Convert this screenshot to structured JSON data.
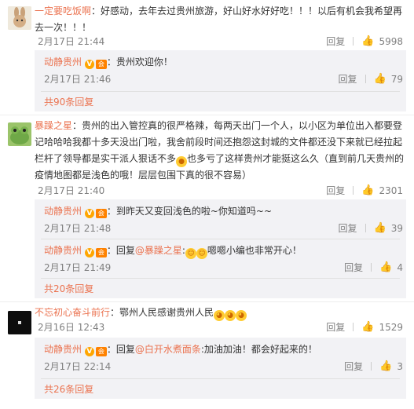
{
  "comments": [
    {
      "user": "一定要吃饭啊",
      "text": "：好感动，去年去过贵州旅游，好山好水好好吃！！！以后有机会我希望再去一次！！！",
      "time": "2月17日 21:44",
      "reply": "回复",
      "likes": "5998",
      "avatar_icon": "rabbit-avatar",
      "replies": [
        {
          "user": "动静贵州",
          "text": "：贵州欢迎你！",
          "time": "2月17日 21:46",
          "reply": "回复",
          "likes": "79"
        }
      ],
      "more": "共90条回复"
    },
    {
      "user": "暴躁之星",
      "text": "：贵州的出入管控真的很严格辣，每两天出门一个人，以小区为单位出入都要登记哈哈哈我都十多天没出门啦，我舍前段时间还抱怨这封城的文件都还没下来就已经拉起栏杆了领导都是实干派人狠话不多",
      "text_tail": "也多亏了这样贵州才能挺这么久（直到前几天贵州的疫情地图都是浅色的哦！层层包围下真的很不容易）",
      "time": "2月17日 21:40",
      "reply": "回复",
      "likes": "2301",
      "avatar_icon": "frog-avatar",
      "replies": [
        {
          "user": "动静贵州",
          "text": "：到昨天又变回浅色的啦~你知道吗~~",
          "time": "2月17日 21:48",
          "reply": "回复",
          "likes": "39"
        },
        {
          "user": "动静贵州",
          "text_pre": "：回复",
          "mention": "@暴躁之星",
          "text": ":",
          "text_post": "嗯嗯小编也非常开心！",
          "time": "2月17日 21:49",
          "reply": "回复",
          "likes": "4"
        }
      ],
      "more": "共20条回复"
    },
    {
      "user": "不忘初心奋斗前行",
      "text": "：鄂州人民感谢贵州人民",
      "time": "2月16日 12:43",
      "reply": "回复",
      "likes": "1529",
      "avatar_icon": "black-avatar",
      "replies": [
        {
          "user": "动静贵州",
          "text_pre": "：回复",
          "mention": "@白开水煮面条",
          "text": ":加油加油！都会好起来的！",
          "time": "2月17日 22:14",
          "reply": "回复",
          "likes": "3"
        }
      ],
      "more": "共26条回复"
    }
  ],
  "badges": {
    "v": "V",
    "member": "会"
  },
  "colors": {
    "username": "#eb7350",
    "subbox": "#f2f2f5",
    "meta": "#808080"
  }
}
